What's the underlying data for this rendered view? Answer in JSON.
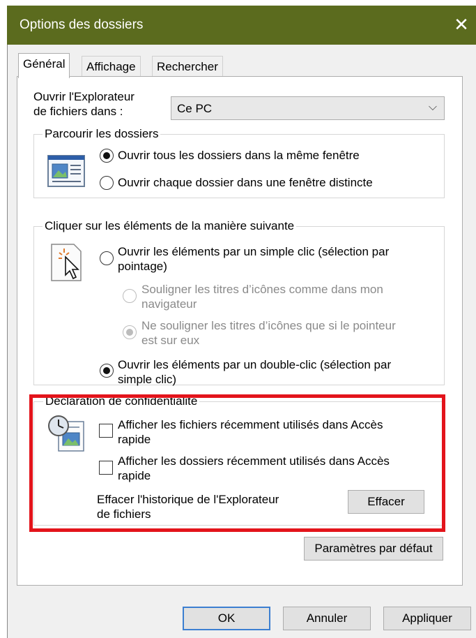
{
  "window": {
    "title": "Options des dossiers",
    "close_symbol": "✕"
  },
  "tabs": [
    {
      "label": "Général",
      "active": true
    },
    {
      "label": "Affichage",
      "active": false
    },
    {
      "label": "Rechercher",
      "active": false
    }
  ],
  "open_in": {
    "label_line1": "Ouvrir l'Explorateur",
    "label_line2": "de fichiers dans :",
    "value": "Ce PC"
  },
  "browse_folders": {
    "legend": "Parcourir les dossiers",
    "options": [
      {
        "label": "Ouvrir tous les dossiers dans la même fenêtre",
        "checked": true
      },
      {
        "label": "Ouvrir chaque dossier dans une fenêtre distincte",
        "checked": false
      }
    ]
  },
  "click_items": {
    "legend": "Cliquer sur les éléments de la manière suivante",
    "single_click": {
      "line1": "Ouvrir les éléments par un simple clic (sélection par",
      "line2": "pointage)",
      "checked": false
    },
    "underline_always": {
      "line1": "Souligner les titres d’icônes comme dans mon",
      "line2": "navigateur",
      "checked": false,
      "disabled": true
    },
    "underline_hover": {
      "line1": "Ne souligner les titres d’icônes que si le pointeur",
      "line2": "est sur eux",
      "checked": true,
      "disabled": true
    },
    "double_click": {
      "line1": "Ouvrir les éléments par un double-clic (sélection par",
      "line2": "simple clic)",
      "checked": true
    }
  },
  "privacy": {
    "legend": "Déclaration de confidentialité",
    "show_recent_files": {
      "line1": "Afficher les fichiers récemment utilisés dans Accès",
      "line2": "rapide",
      "checked": false
    },
    "show_frequent_folders": {
      "line1": "Afficher les dossiers récemment utilisés dans Accès",
      "line2": "rapide",
      "checked": false
    },
    "clear_history_line1": "Effacer l'historique de l'Explorateur",
    "clear_history_line2": "de fichiers",
    "clear_button": "Effacer"
  },
  "buttons": {
    "restore_defaults": "Paramètres par défaut",
    "ok": "OK",
    "cancel": "Annuler",
    "apply": "Appliquer"
  },
  "colors": {
    "titlebar": "#5b6b1e",
    "highlight": "#e3141b",
    "default_button_border": "#3c7fd1"
  }
}
